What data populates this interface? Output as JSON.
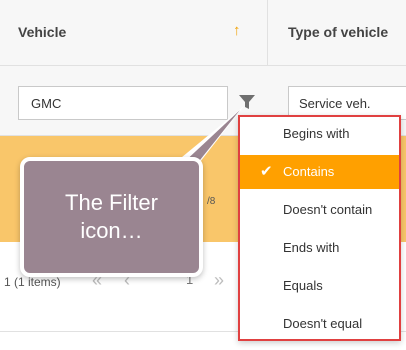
{
  "grid": {
    "columns": [
      {
        "label": "Vehicle",
        "sort": "ascending"
      },
      {
        "label": "Type of vehicle"
      }
    ],
    "sort_icon": "arrow-up-icon"
  },
  "filters": {
    "vehicle_value": "GMC",
    "type_value": "Service veh."
  },
  "pager": {
    "count_text": "1 (1 items)",
    "page": "1",
    "first_icon": "double-chevron-left-icon",
    "prev_icon": "chevron-left-icon",
    "last_icon": "double-chevron-right-icon",
    "peek_text": "/8"
  },
  "callout": {
    "line1": "The Filter",
    "line2": "icon…"
  },
  "filter_menu": {
    "items": [
      {
        "label": "Begins with",
        "selected": false
      },
      {
        "label": "Contains",
        "selected": true
      },
      {
        "label": "Doesn't contain",
        "selected": false
      },
      {
        "label": "Ends with",
        "selected": false
      },
      {
        "label": "Equals",
        "selected": false
      },
      {
        "label": "Doesn't equal",
        "selected": false
      }
    ],
    "highlight_border_color": "#e04040",
    "selected_color": "#ffa000"
  },
  "colors": {
    "accent": "#f0a30a",
    "row_band": "#f9c66a",
    "callout_bg": "#9a8591"
  }
}
